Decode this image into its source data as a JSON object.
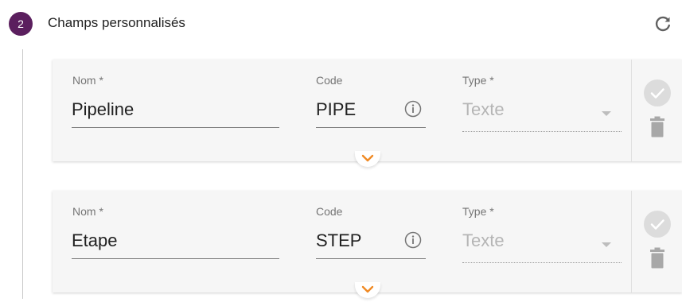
{
  "header": {
    "step_number": "2",
    "title": "Champs personnalisés",
    "refresh_icon": "refresh-icon"
  },
  "fields": [
    {
      "name_label": "Nom *",
      "name_value": "Pipeline",
      "code_label": "Code",
      "code_value": "PIPE",
      "type_label": "Type *",
      "type_value": "Texte"
    },
    {
      "name_label": "Nom *",
      "name_value": "Etape",
      "code_label": "Code",
      "code_value": "STEP",
      "type_label": "Type *",
      "type_value": "Texte"
    }
  ],
  "colors": {
    "badge": "#5b1f5e",
    "expand_chevron": "#f08a24",
    "disabled": "#b5b5b5"
  }
}
